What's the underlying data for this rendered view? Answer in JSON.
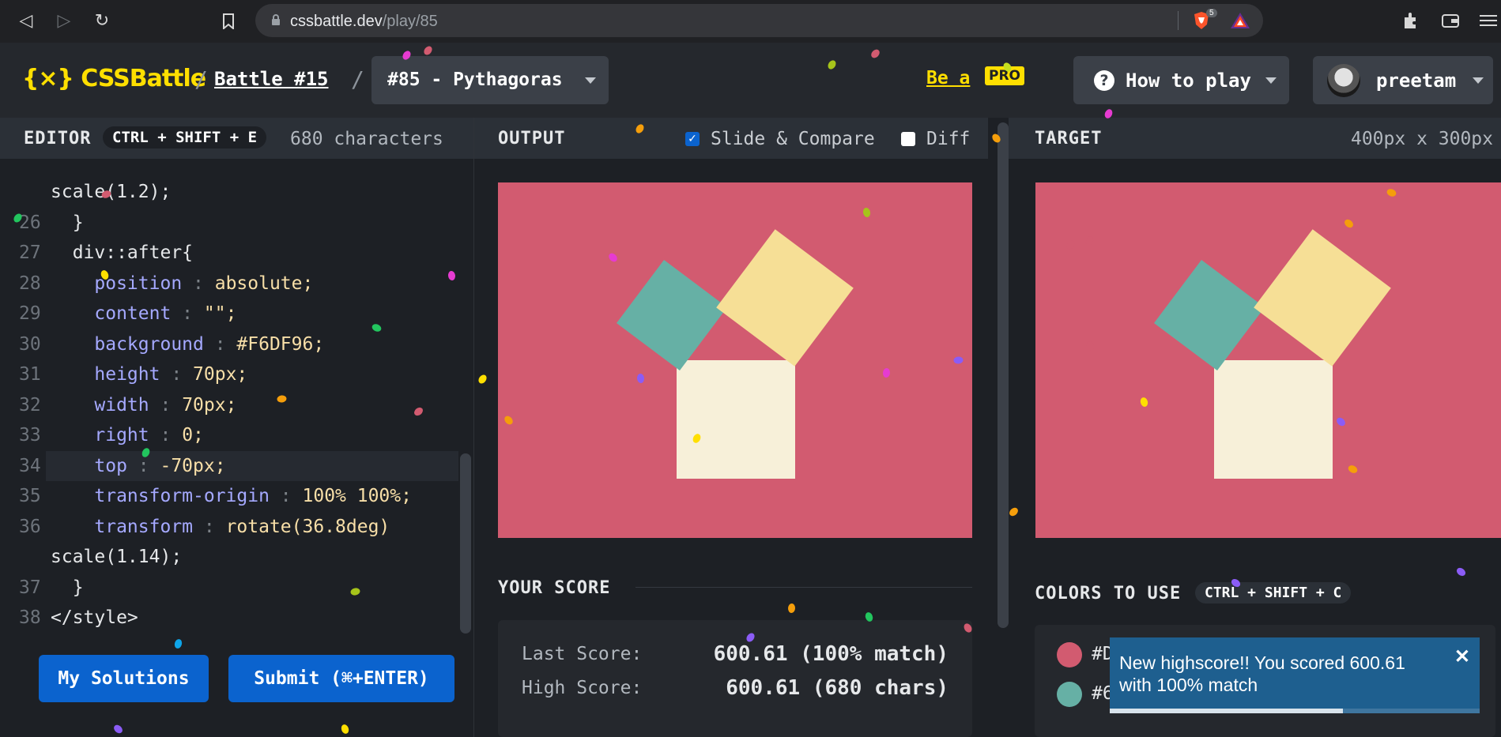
{
  "browser": {
    "url_host": "cssbattle.dev",
    "url_path": "/play/85",
    "shield_count": "5"
  },
  "header": {
    "logo": "{⨯} CSSBattle",
    "sep": "/",
    "battle": "Battle #15",
    "level": "#85 - Pythagoras",
    "pro_text": "Be a",
    "pro_badge": "PRO",
    "how_to_play": "How to play",
    "username": "preetam"
  },
  "editor": {
    "title": "EDITOR",
    "shortcut": "CTRL + SHIFT + E",
    "char_count": "680 characters",
    "lines": [
      {
        "n": "",
        "text": "scale(1.2);"
      },
      {
        "n": "26",
        "text": "  }"
      },
      {
        "n": "27",
        "text": "  div::after{"
      },
      {
        "n": "28",
        "text": "    position : absolute;"
      },
      {
        "n": "29",
        "text": "    content : \"\";"
      },
      {
        "n": "30",
        "text": "    background : #F6DF96;"
      },
      {
        "n": "31",
        "text": "    height : 70px;"
      },
      {
        "n": "32",
        "text": "    width : 70px;"
      },
      {
        "n": "33",
        "text": "    right : 0;"
      },
      {
        "n": "34",
        "text": "    top : -70px;"
      },
      {
        "n": "35",
        "text": "    transform-origin : 100% 100%;"
      },
      {
        "n": "36",
        "text": "    transform : rotate(36.8deg)"
      },
      {
        "n": "",
        "text": "scale(1.14);"
      },
      {
        "n": "37",
        "text": "  }"
      },
      {
        "n": "38",
        "text": "</style>"
      }
    ],
    "active_line": 9,
    "my_solutions": "My Solutions",
    "submit": "Submit (⌘+ENTER)"
  },
  "output": {
    "title": "OUTPUT",
    "slide_compare": "Slide & Compare",
    "slide_compare_checked": true,
    "diff": "Diff",
    "diff_checked": false
  },
  "score": {
    "title": "YOUR SCORE",
    "last_label": "Last Score:",
    "last_value": "600.61 (100% match)",
    "high_label": "High Score:",
    "high_value": "600.61 (680 chars)"
  },
  "target": {
    "title": "TARGET",
    "dims": "400px x 300px"
  },
  "colors": {
    "title": "COLORS TO USE",
    "shortcut": "CTRL + SHIFT + C",
    "items": [
      {
        "label": "#D",
        "hex": "#d25b70"
      },
      {
        "label": "#6",
        "hex": "#66b0a5"
      }
    ]
  },
  "toast": {
    "message": "New highscore!! You scored 600.61 with 100% match",
    "close": "✕",
    "progress": 0.63
  },
  "palette": {
    "bg": "#d25b70",
    "teal": "#66b0a5",
    "yellow": "#f6df96",
    "cream": "#f7f0d9",
    "brand": "#ffdf00",
    "button": "#0b63ce"
  }
}
